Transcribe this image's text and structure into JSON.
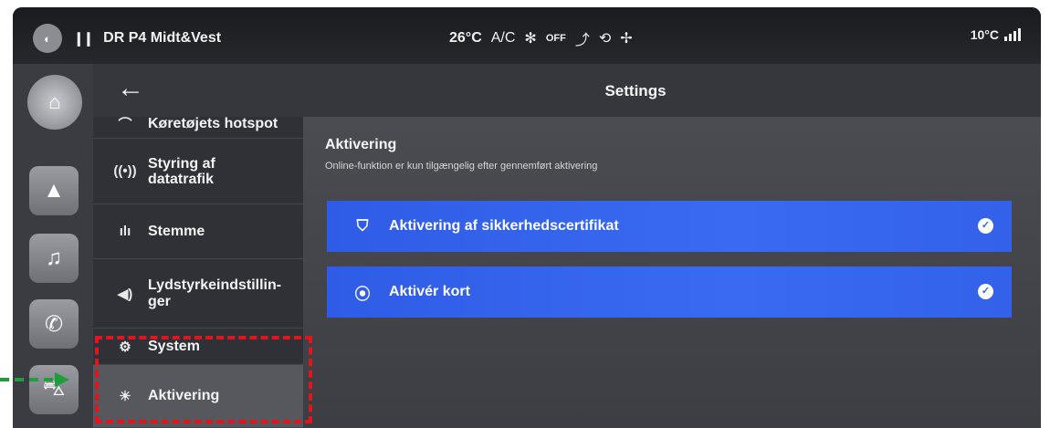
{
  "statusbar": {
    "station": "DR P4 Midt&Vest",
    "temp_inside": "26°C",
    "ac": "A/C",
    "fan_off": "OFF",
    "outside_temp": "10°C"
  },
  "header": {
    "title": "Settings"
  },
  "menu": {
    "items": [
      {
        "label": "Køretøjets hotspot",
        "icon": "hotspot-icon"
      },
      {
        "label": "Styring af datatrafik",
        "icon": "antenna-icon"
      },
      {
        "label": "Stemme",
        "icon": "voice-icon"
      },
      {
        "label": "Lydstyrkeindstillin-ger",
        "icon": "speaker-icon"
      },
      {
        "label": "System",
        "icon": "gear-icon"
      },
      {
        "label": "Aktivering",
        "icon": "activation-icon"
      }
    ]
  },
  "content": {
    "title": "Aktivering",
    "subtitle": "Online-funktion er kun tilgængelig efter gennemført aktivering",
    "rows": [
      {
        "label": "Aktivering af sikkerhedscertifikat",
        "icon": "shield-icon",
        "checked": true
      },
      {
        "label": "Aktivér kort",
        "icon": "location-pin-icon",
        "checked": true
      }
    ]
  },
  "colors": {
    "accent_blue": "#3361ea",
    "highlight_red": "#e0161c",
    "arrow_green": "#1f9d3a"
  }
}
